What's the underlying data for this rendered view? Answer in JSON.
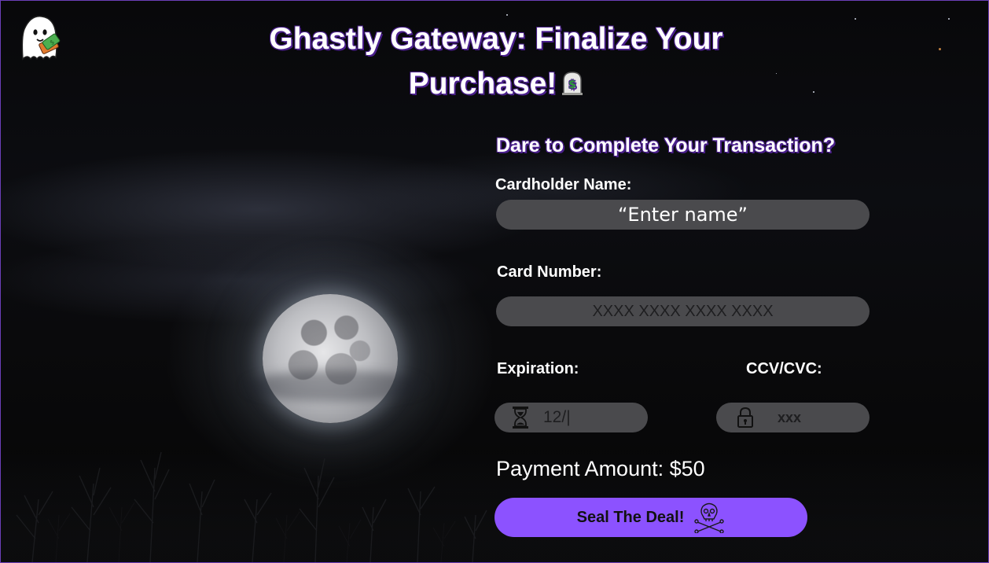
{
  "header": {
    "title_line1": "Ghastly Gateway: Finalize Your",
    "title_line2": "Purchase!",
    "logo_icon": "ghost-with-money-icon",
    "title_icon": "dollar-tombstone-icon"
  },
  "form": {
    "heading": "Dare to Complete Your Transaction?",
    "cardholder_label": "Cardholder Name:",
    "cardholder_value": "“Enter name”",
    "card_number_label": "Card Number:",
    "card_number_placeholder": "XXXX XXXX XXXX XXXX",
    "expiration_label": "Expiration:",
    "expiration_value": "12/|",
    "expiration_icon": "hourglass-icon",
    "ccv_label": "CCV/CVC:",
    "ccv_placeholder": "xxx",
    "ccv_icon": "lock-icon",
    "payment_amount": "Payment Amount: $50",
    "submit_label": "Seal The Deal!",
    "submit_icon": "skull-crossbones-icon"
  },
  "colors": {
    "accent": "#8c52ff",
    "field_bg": "#4a4a4d",
    "title_shadow": "#4a1f8c",
    "border": "#6b3fb8"
  }
}
